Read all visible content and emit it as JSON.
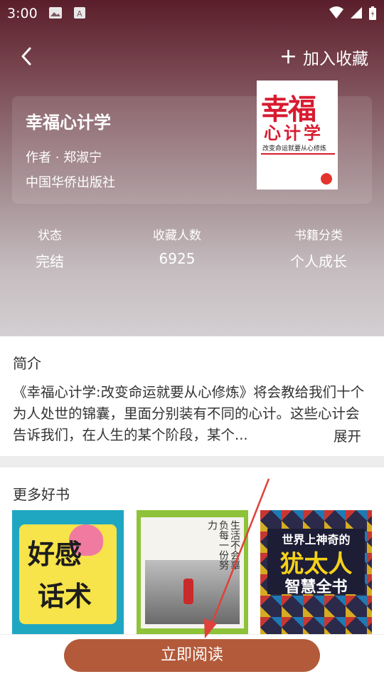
{
  "status_bar": {
    "time": "3:00"
  },
  "nav": {
    "favorite_label": "加入收藏",
    "favorite_plus": "+"
  },
  "book": {
    "title": "幸福心计学",
    "author": "作者 · 郑淑宁",
    "publisher": "中国华侨出版社",
    "cover": {
      "title_line1": "幸福",
      "title_line2": "心计学",
      "subtitle": "改变命运就要从心修炼"
    }
  },
  "stats": [
    {
      "label": "状态",
      "value": "完结"
    },
    {
      "label": "收藏人数",
      "value": "6925"
    },
    {
      "label": "书籍分类",
      "value": "个人成长"
    }
  ],
  "intro": {
    "heading": "简介",
    "text": "《幸福心计学:改变命运就要从心修炼》将会教给我们十个为人处世的锦囊，里面分别装有不同的心计。这些心计会告诉我们，在人生的某个阶段，某个...",
    "expand_label": "展开"
  },
  "more": {
    "heading": "更多好书",
    "books": [
      {
        "cover_text_1": "好感",
        "cover_text_2": "话术"
      },
      {
        "cover_text": "生活不会辜负每一份努力"
      },
      {
        "cover_line1": "世界上神奇的",
        "cover_line2": "犹太人",
        "cover_line3": "智慧全书"
      }
    ]
  },
  "bottom": {
    "read_label": "立即阅读"
  },
  "colors": {
    "accent": "#b35a3a",
    "arrow": "#e0413a"
  }
}
